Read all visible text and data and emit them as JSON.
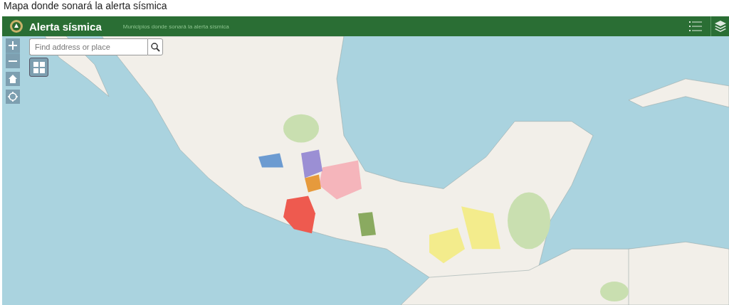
{
  "page_caption": "Mapa donde sonará la alerta sísmica",
  "header": {
    "title": "Alerta sísmica",
    "subtitle": "Municipios donde sonará la alerta sísmica"
  },
  "search": {
    "placeholder": "Find address or place"
  }
}
